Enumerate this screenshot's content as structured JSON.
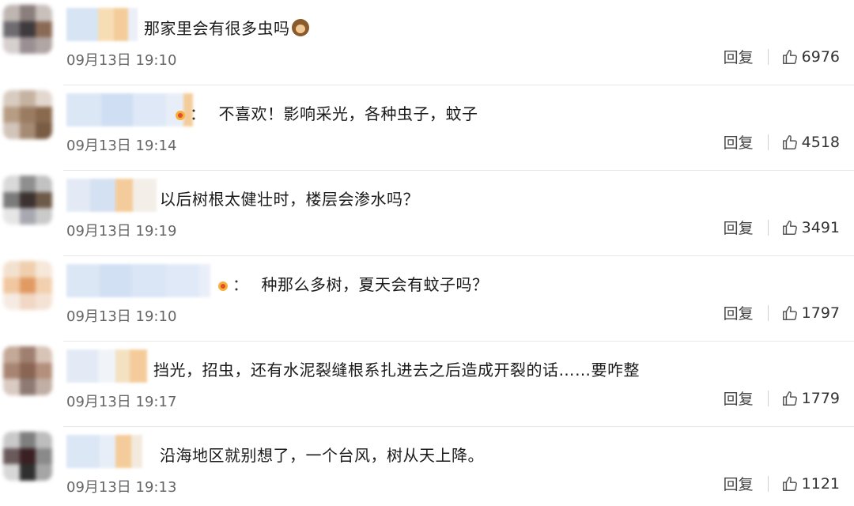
{
  "comments": [
    {
      "text": "那家里会有很多虫吗",
      "has_colon": false,
      "has_badge": false,
      "emoji": "monkey-face",
      "time": "09月13日 19:10",
      "reply": "回复",
      "likes": "6976"
    },
    {
      "text": "不喜欢！影响采光，各种虫子，蚊子",
      "has_colon": true,
      "colon": "：",
      "has_badge": true,
      "emoji": "",
      "time": "09月13日 19:14",
      "reply": "回复",
      "likes": "4518"
    },
    {
      "text": "以后树根太健壮时，楼层会渗水吗？",
      "has_colon": false,
      "has_badge": false,
      "emoji": "",
      "time": "09月13日 19:19",
      "reply": "回复",
      "likes": "3491"
    },
    {
      "text": "种那么多树，夏天会有蚊子吗？",
      "has_colon": true,
      "colon": "：",
      "has_badge": true,
      "emoji": "",
      "time": "09月13日 19:10",
      "reply": "回复",
      "likes": "1797"
    },
    {
      "text": "挡光，招虫，还有水泥裂缝根系扎进去之后造成开裂的话……要咋整",
      "has_colon": false,
      "has_badge": false,
      "emoji": "",
      "time": "09月13日 19:17",
      "reply": "回复",
      "likes": "1779"
    },
    {
      "text": "沿海地区就别想了，一个台风，树从天上降。",
      "has_colon": false,
      "has_badge": false,
      "emoji": "",
      "time": "09月13日 19:13",
      "reply": "回复",
      "likes": "1121"
    }
  ],
  "icons": {
    "like": "thumbs-up-icon",
    "badge": "fan-badge-icon"
  },
  "colors": {
    "text": "#1a1a1a",
    "meta": "#666666",
    "divider": "#e8e8e8",
    "badge": "#f6b13a"
  }
}
